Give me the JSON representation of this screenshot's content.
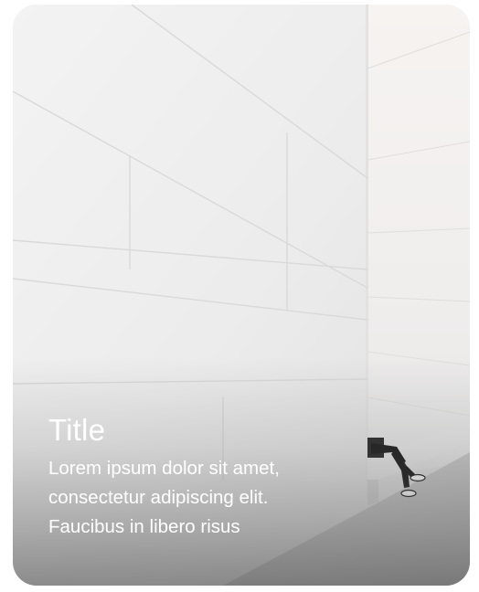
{
  "card": {
    "title": "Title",
    "body": "Lorem ipsum dolor sit amet,\nconsectetur adipiscing elit.\nFaucibus in libero risus",
    "image": "white-stone-wall-with-person-sitting"
  }
}
